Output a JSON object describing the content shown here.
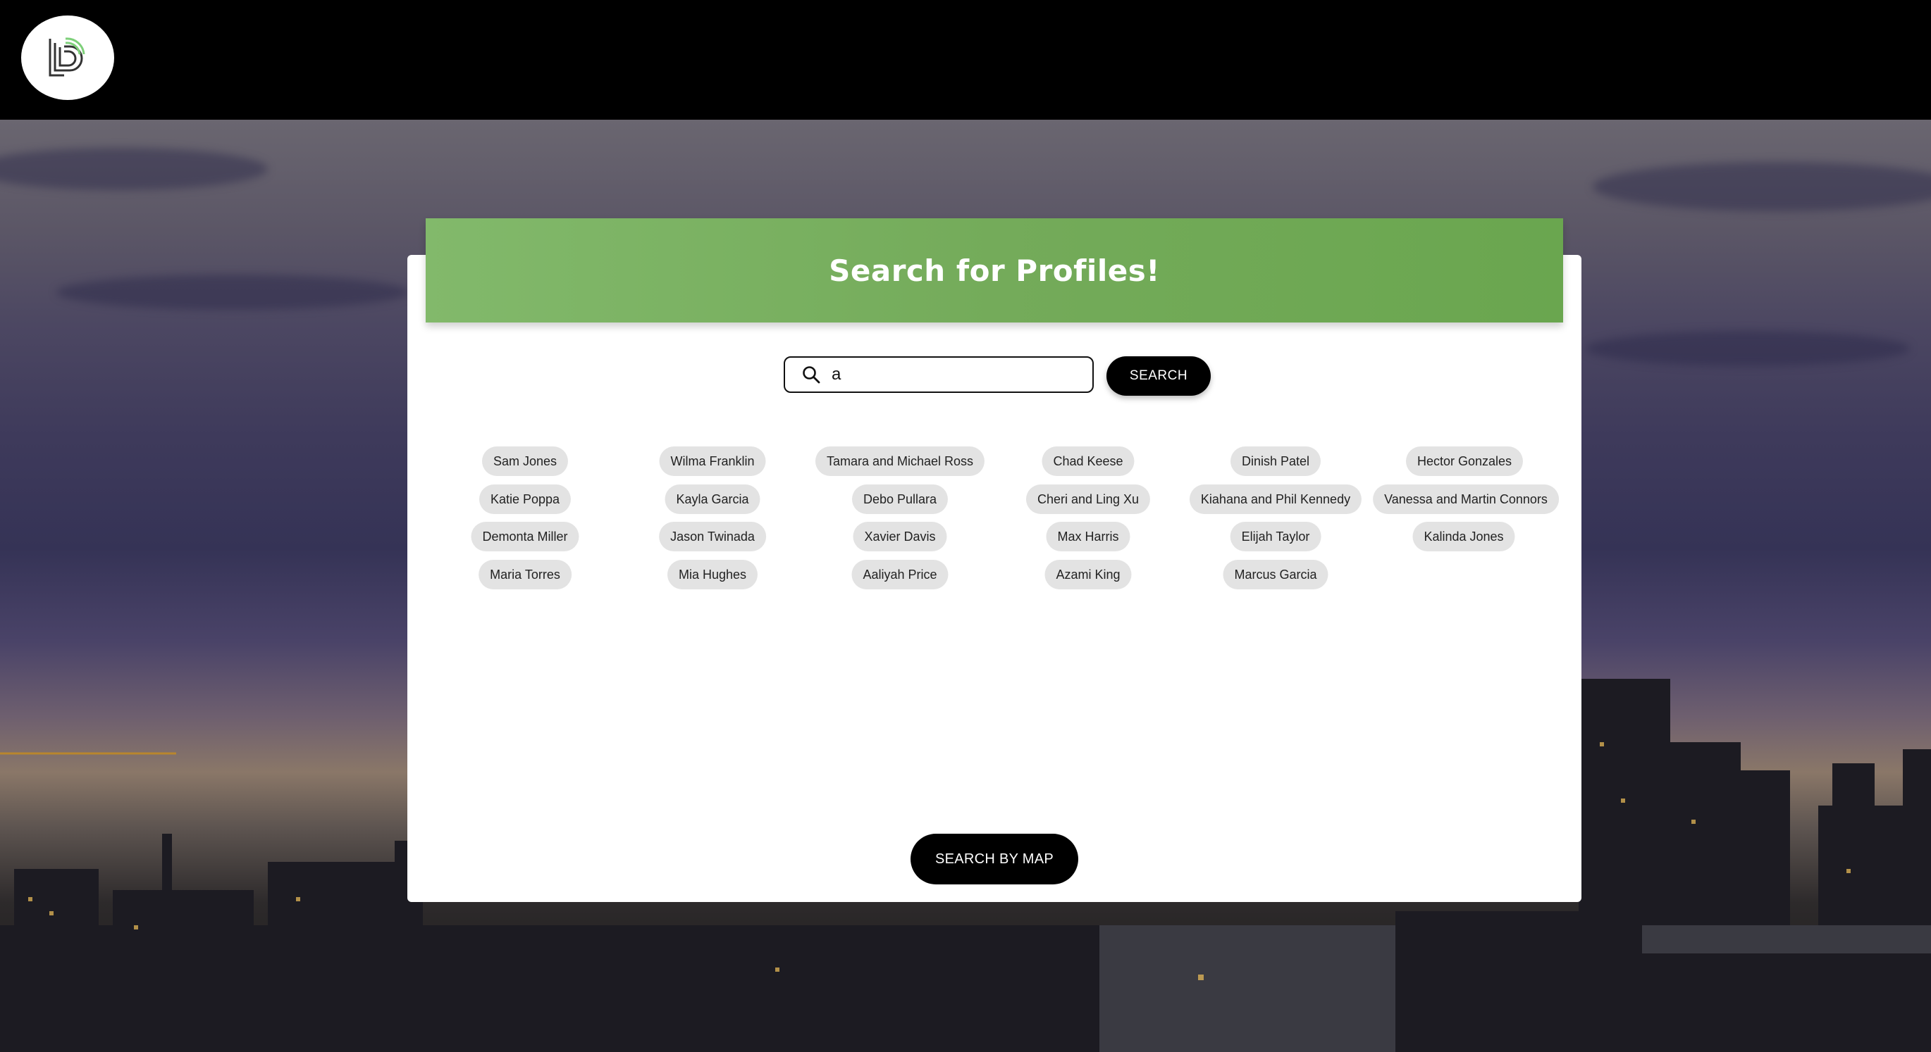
{
  "header": {
    "logo_icon": "b-logo-icon"
  },
  "banner": {
    "title": "Search for Profiles!"
  },
  "search": {
    "value": "a",
    "button_label": "SEARCH"
  },
  "profiles": {
    "col1": [
      "Sam Jones",
      "Katie Poppa",
      "Demonta Miller",
      "Maria Torres"
    ],
    "col2": [
      "Wilma Franklin",
      "Kayla Garcia",
      "Jason Twinada",
      "Mia Hughes"
    ],
    "col3": [
      "Tamara and Michael Ross",
      "Debo Pullara",
      "Xavier Davis",
      "Aaliyah Price"
    ],
    "col4": [
      "Chad Keese",
      "Cheri and Ling Xu",
      "Max Harris",
      "Azami King"
    ],
    "col5": [
      "Dinish Patel",
      "Kiahana and Phil Kennedy",
      "Elijah Taylor",
      "Marcus Garcia"
    ],
    "col6": [
      "Hector Gonzales",
      "Vanessa and Martin Connors",
      "Kalinda Jones"
    ]
  },
  "footer": {
    "map_button_label": "SEARCH BY MAP"
  },
  "colors": {
    "banner": "#74ab5a",
    "button": "#000000",
    "chip": "#e3e3e3"
  }
}
